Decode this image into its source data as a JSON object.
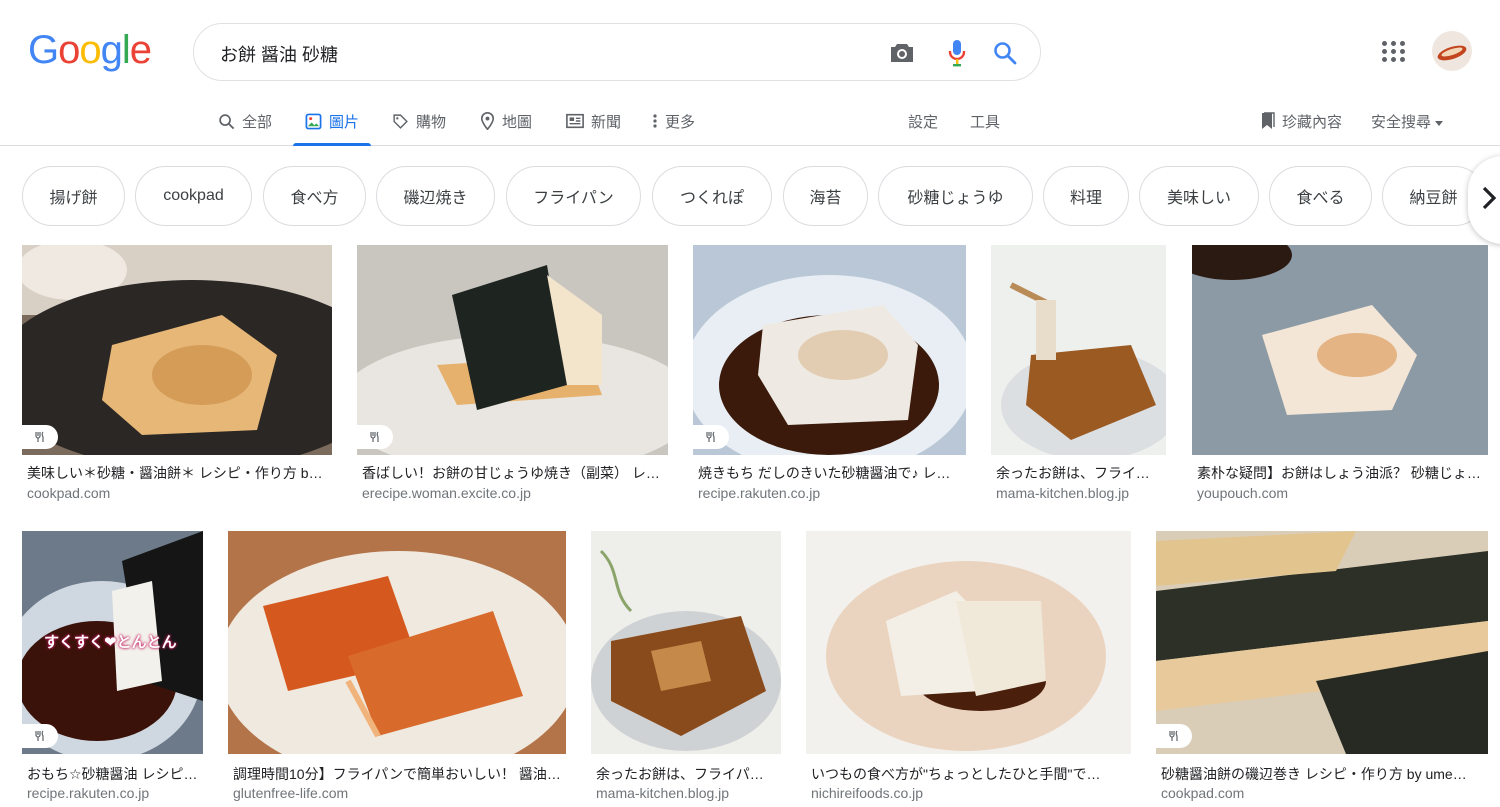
{
  "logo": {
    "text": "Google"
  },
  "search": {
    "query": "お餅 醤油 砂糖"
  },
  "tabs": [
    {
      "label": "全部"
    },
    {
      "label": "圖片"
    },
    {
      "label": "購物"
    },
    {
      "label": "地圖"
    },
    {
      "label": "新聞"
    },
    {
      "label": "更多"
    }
  ],
  "tools": {
    "settings": "設定",
    "tools": "工具",
    "saved": "珍藏內容",
    "safesearch": "安全搜尋"
  },
  "chips": [
    "揚げ餅",
    "cookpad",
    "食べ方",
    "磯辺焼き",
    "フライパン",
    "つくれぽ",
    "海苔",
    "砂糖じょうゆ",
    "料理",
    "美味しい",
    "食べる",
    "納豆餅"
  ],
  "results": [
    {
      "title": "美味しい＊砂糖・醤油餅＊ レシピ・作り方 by …",
      "source": "cookpad.com"
    },
    {
      "title": "香ばしい！お餅の甘じょうゆ焼き（副菜） レシピ…",
      "source": "erecipe.woman.excite.co.jp"
    },
    {
      "title": "焼きもち だしのきいた砂糖醤油で♪ レシピ・…",
      "source": "recipe.rakuten.co.jp"
    },
    {
      "title": "余ったお餅は、フライパ…",
      "source": "mama-kitchen.blog.jp"
    },
    {
      "title": "素朴な疑問】お餅はしょう油派？ 砂糖じょ…",
      "source": "youpouch.com"
    },
    {
      "title": "おもち☆砂糖醤油 レシピ…",
      "source": "recipe.rakuten.co.jp"
    },
    {
      "title": "調理時間10分】フライパンで簡単おいしい！ 醤油…",
      "source": "glutenfree-life.com"
    },
    {
      "title": "余ったお餅は、フライパ…",
      "source": "mama-kitchen.blog.jp"
    },
    {
      "title": "いつもの食べ方が\"ちょっとしたひと手間\"で…",
      "source": "nichireifoods.co.jp"
    },
    {
      "title": "砂糖醤油餅の磯辺巻き レシピ・作り方 by ume…",
      "source": "cookpad.com"
    }
  ],
  "overlay_text": {
    "r6": "すくすく❤とんとん"
  },
  "colors": {
    "accent": "#1a73e8",
    "border": "#dadce0",
    "muted": "#70757a"
  }
}
